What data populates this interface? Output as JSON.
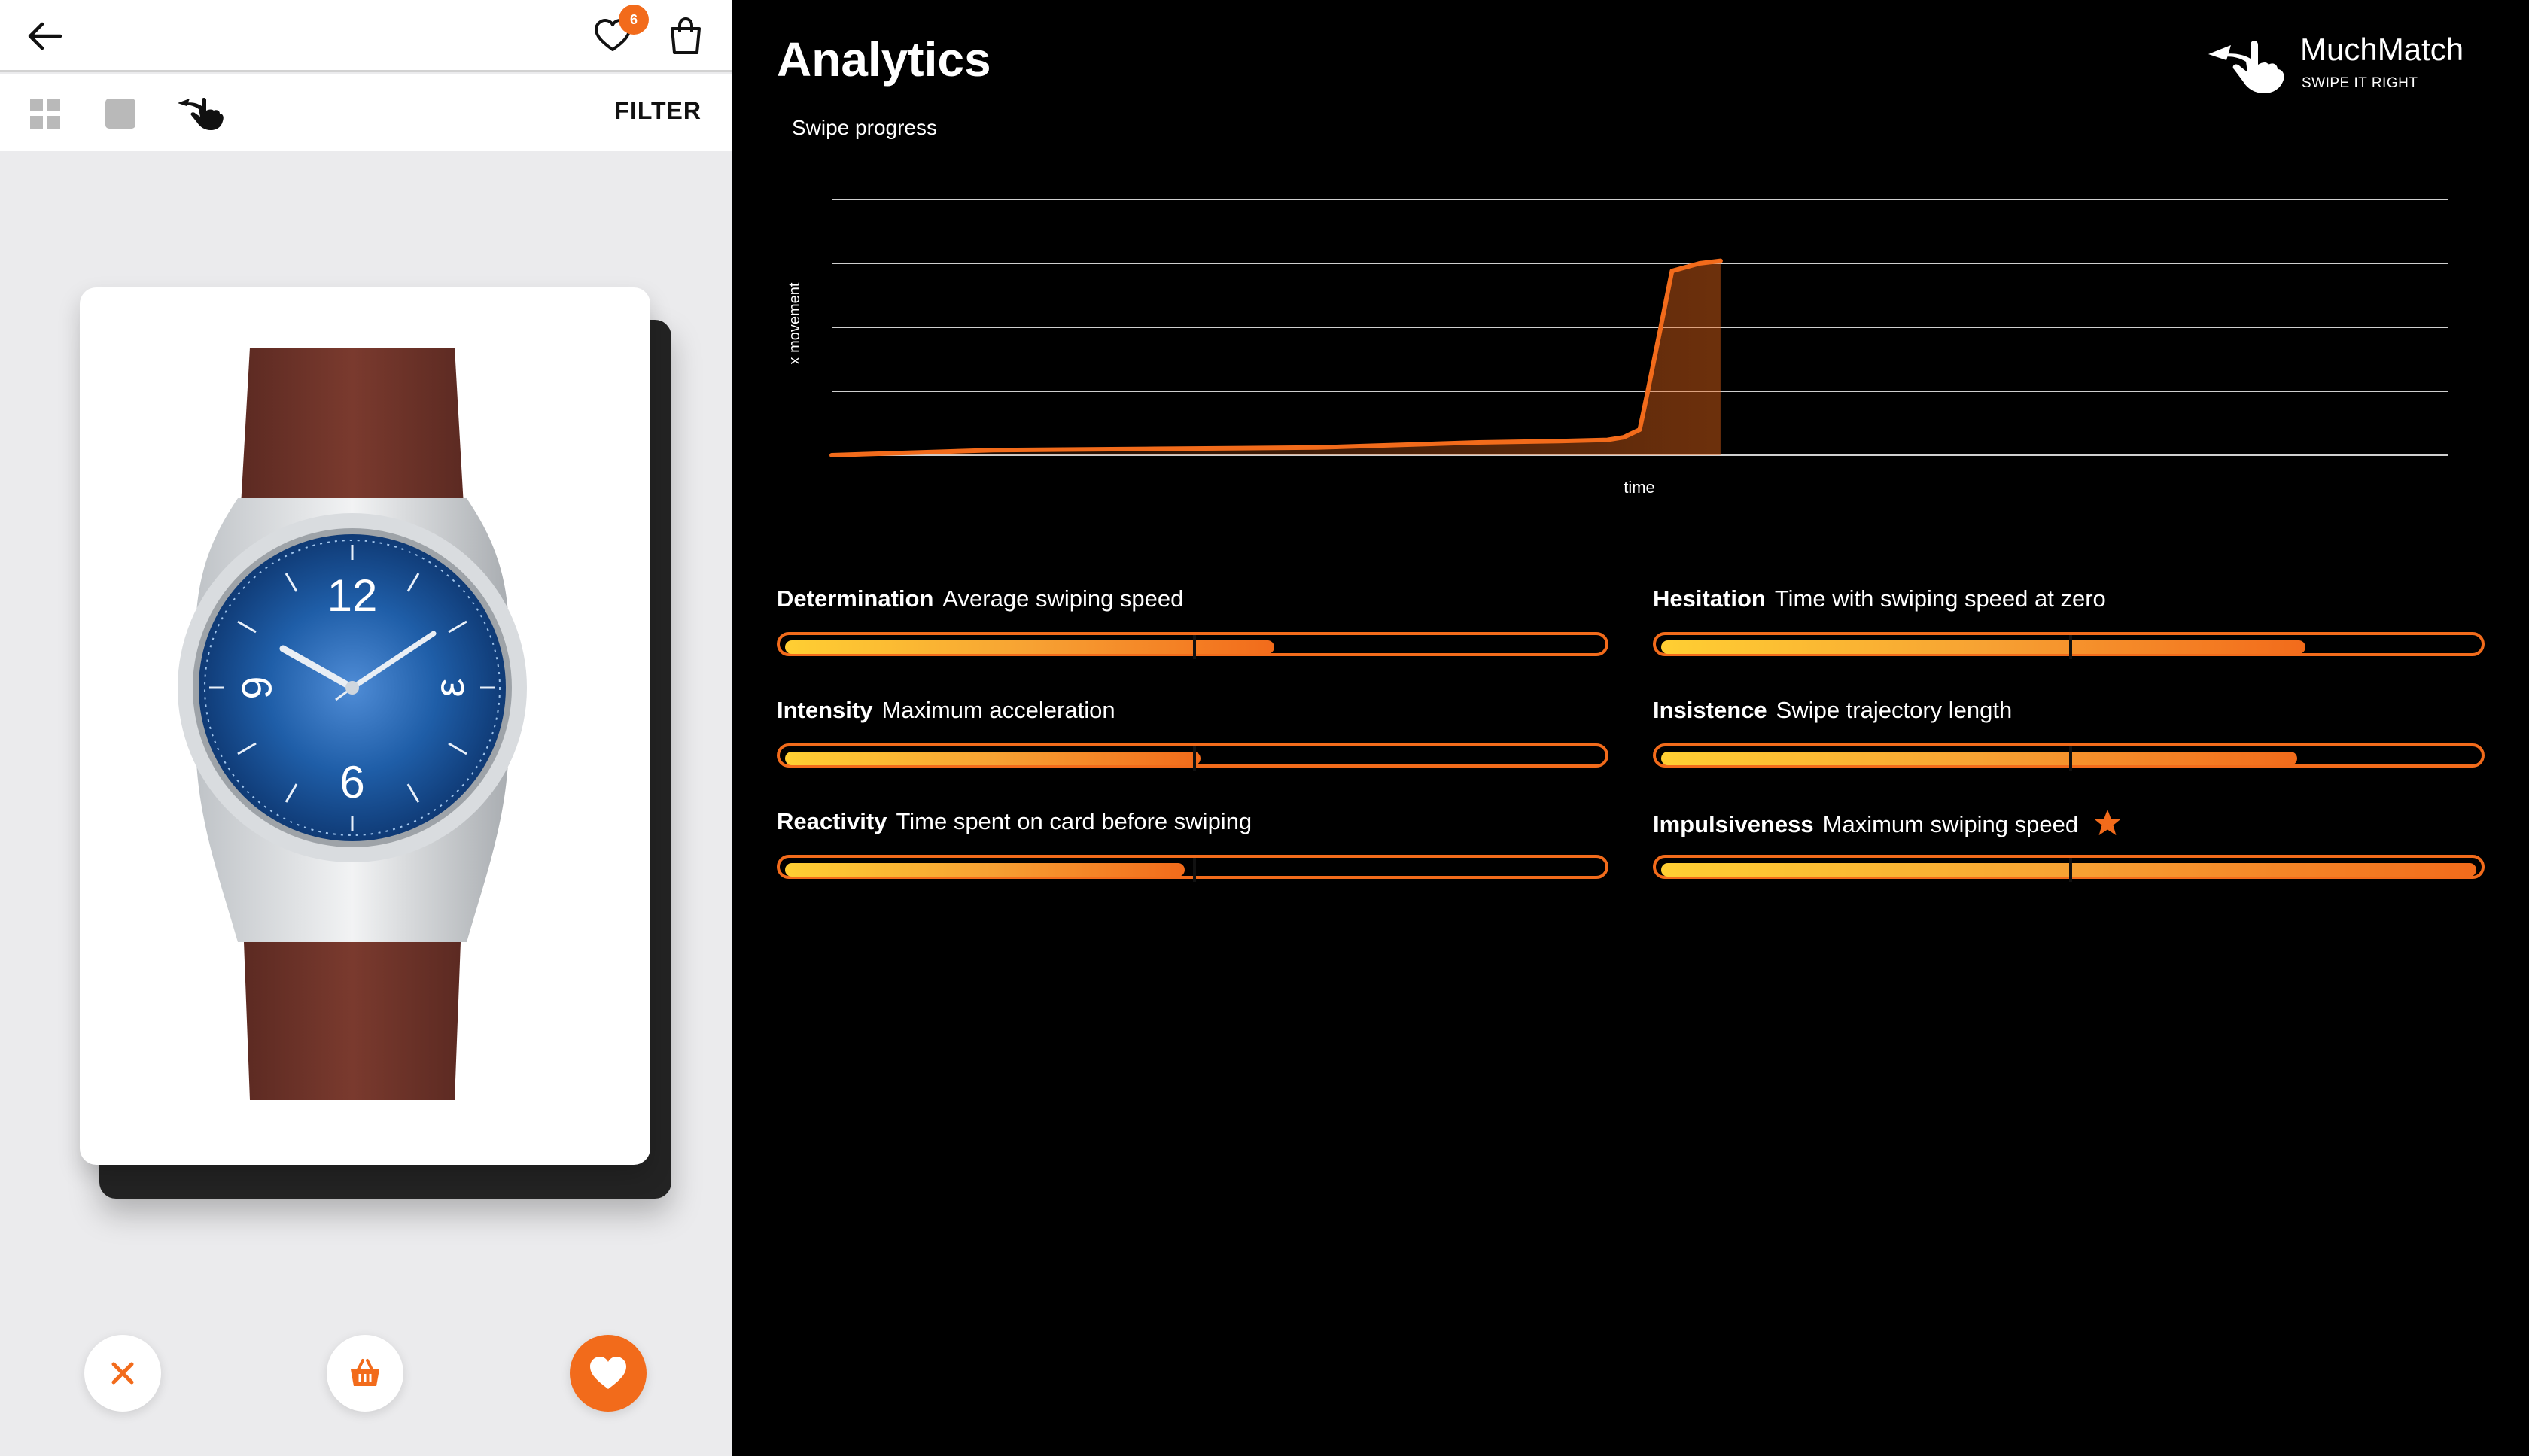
{
  "phone": {
    "wishlist_count": "6",
    "filter_label": "FILTER"
  },
  "analytics": {
    "title": "Analytics",
    "brand": {
      "name": "MuchMatch",
      "tagline": "SWIPE IT RIGHT"
    },
    "chart_title": "Swipe progress",
    "chart_data": {
      "type": "area",
      "title": "Swipe progress",
      "xlabel": "time",
      "ylabel": "x movement",
      "grid": true,
      "x": [
        0,
        0.1,
        0.2,
        0.3,
        0.4,
        0.45,
        0.48,
        0.49,
        0.5,
        0.505,
        0.513,
        0.52,
        0.537,
        0.55
      ],
      "y": [
        0.0,
        0.02,
        0.025,
        0.03,
        0.05,
        0.055,
        0.06,
        0.07,
        0.1,
        0.25,
        0.5,
        0.72,
        0.75,
        0.76
      ],
      "xlim": [
        0,
        1
      ],
      "ylim": [
        0,
        1
      ],
      "color": "#f26b1b"
    },
    "metrics": [
      {
        "name": "Determination",
        "desc": "Average swiping speed",
        "value": 0.6,
        "marker": 0.5,
        "star": false
      },
      {
        "name": "Hesitation",
        "desc": "Time with swiping speed at zero",
        "value": 0.79,
        "marker": 0.5,
        "star": false
      },
      {
        "name": "Intensity",
        "desc": "Maximum acceleration",
        "value": 0.51,
        "marker": 0.5,
        "star": false
      },
      {
        "name": "Insistence",
        "desc": "Swipe trajectory length",
        "value": 0.78,
        "marker": 0.5,
        "star": false
      },
      {
        "name": "Reactivity",
        "desc": "Time spent on card before swiping",
        "value": 0.49,
        "marker": 0.5,
        "star": false
      },
      {
        "name": "Impulsiveness",
        "desc": "Maximum swiping speed",
        "value": 1.0,
        "marker": 0.5,
        "star": true
      }
    ]
  },
  "colors": {
    "accent": "#f26b1b",
    "gradient_start": "#ffcf33",
    "background": "#000000"
  },
  "icons": {
    "back": "arrow-left-icon",
    "wishlist": "heart-outline-icon",
    "bag": "shopping-bag-icon",
    "grid": "grid-view-icon",
    "single": "single-view-icon",
    "swipe": "swipe-hand-icon",
    "dislike": "close-icon",
    "cart": "basket-icon",
    "like": "heart-icon",
    "star": "star-icon"
  }
}
